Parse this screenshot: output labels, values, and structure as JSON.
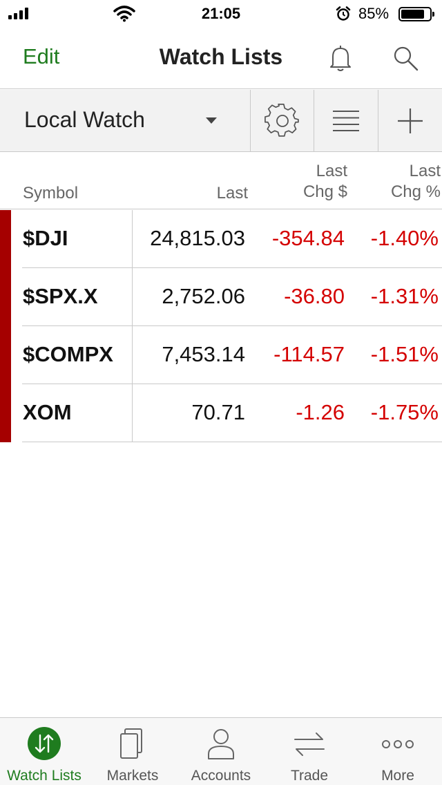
{
  "status_bar": {
    "time": "21:05",
    "battery_percent": "85%",
    "battery_level": 0.85,
    "signal_bars": 4
  },
  "nav": {
    "edit_label": "Edit",
    "title": "Watch Lists",
    "icons": [
      "bell-icon",
      "search-icon"
    ]
  },
  "toolbar": {
    "selected_list": "Local Watch",
    "icons": [
      "gear-icon",
      "list-icon",
      "plus-icon"
    ]
  },
  "table": {
    "headers": {
      "symbol": "Symbol",
      "last": "Last",
      "chg_line1": "Last",
      "chg_line2": "Chg $",
      "pct_line1": "Last",
      "pct_line2": "Chg %"
    },
    "rows": [
      {
        "symbol": "$DJI",
        "last": "24,815.03",
        "chg": "-354.84",
        "pct": "-1.40%"
      },
      {
        "symbol": "$SPX.X",
        "last": "2,752.06",
        "chg": "-36.80",
        "pct": "-1.31%"
      },
      {
        "symbol": "$COMPX",
        "last": "7,453.14",
        "chg": "-114.57",
        "pct": "-1.51%"
      },
      {
        "symbol": "XOM",
        "last": "70.71",
        "chg": "-1.26",
        "pct": "-1.75%"
      }
    ]
  },
  "tabs": [
    {
      "label": "Watch Lists",
      "icon": "watch-lists-icon",
      "active": true
    },
    {
      "label": "Markets",
      "icon": "markets-icon",
      "active": false
    },
    {
      "label": "Accounts",
      "icon": "accounts-icon",
      "active": false
    },
    {
      "label": "Trade",
      "icon": "trade-icon",
      "active": false
    },
    {
      "label": "More",
      "icon": "more-icon",
      "active": false
    }
  ],
  "colors": {
    "accent_green": "#1f7c1f",
    "negative_red": "#d40000",
    "row_marker": "#a50000"
  }
}
